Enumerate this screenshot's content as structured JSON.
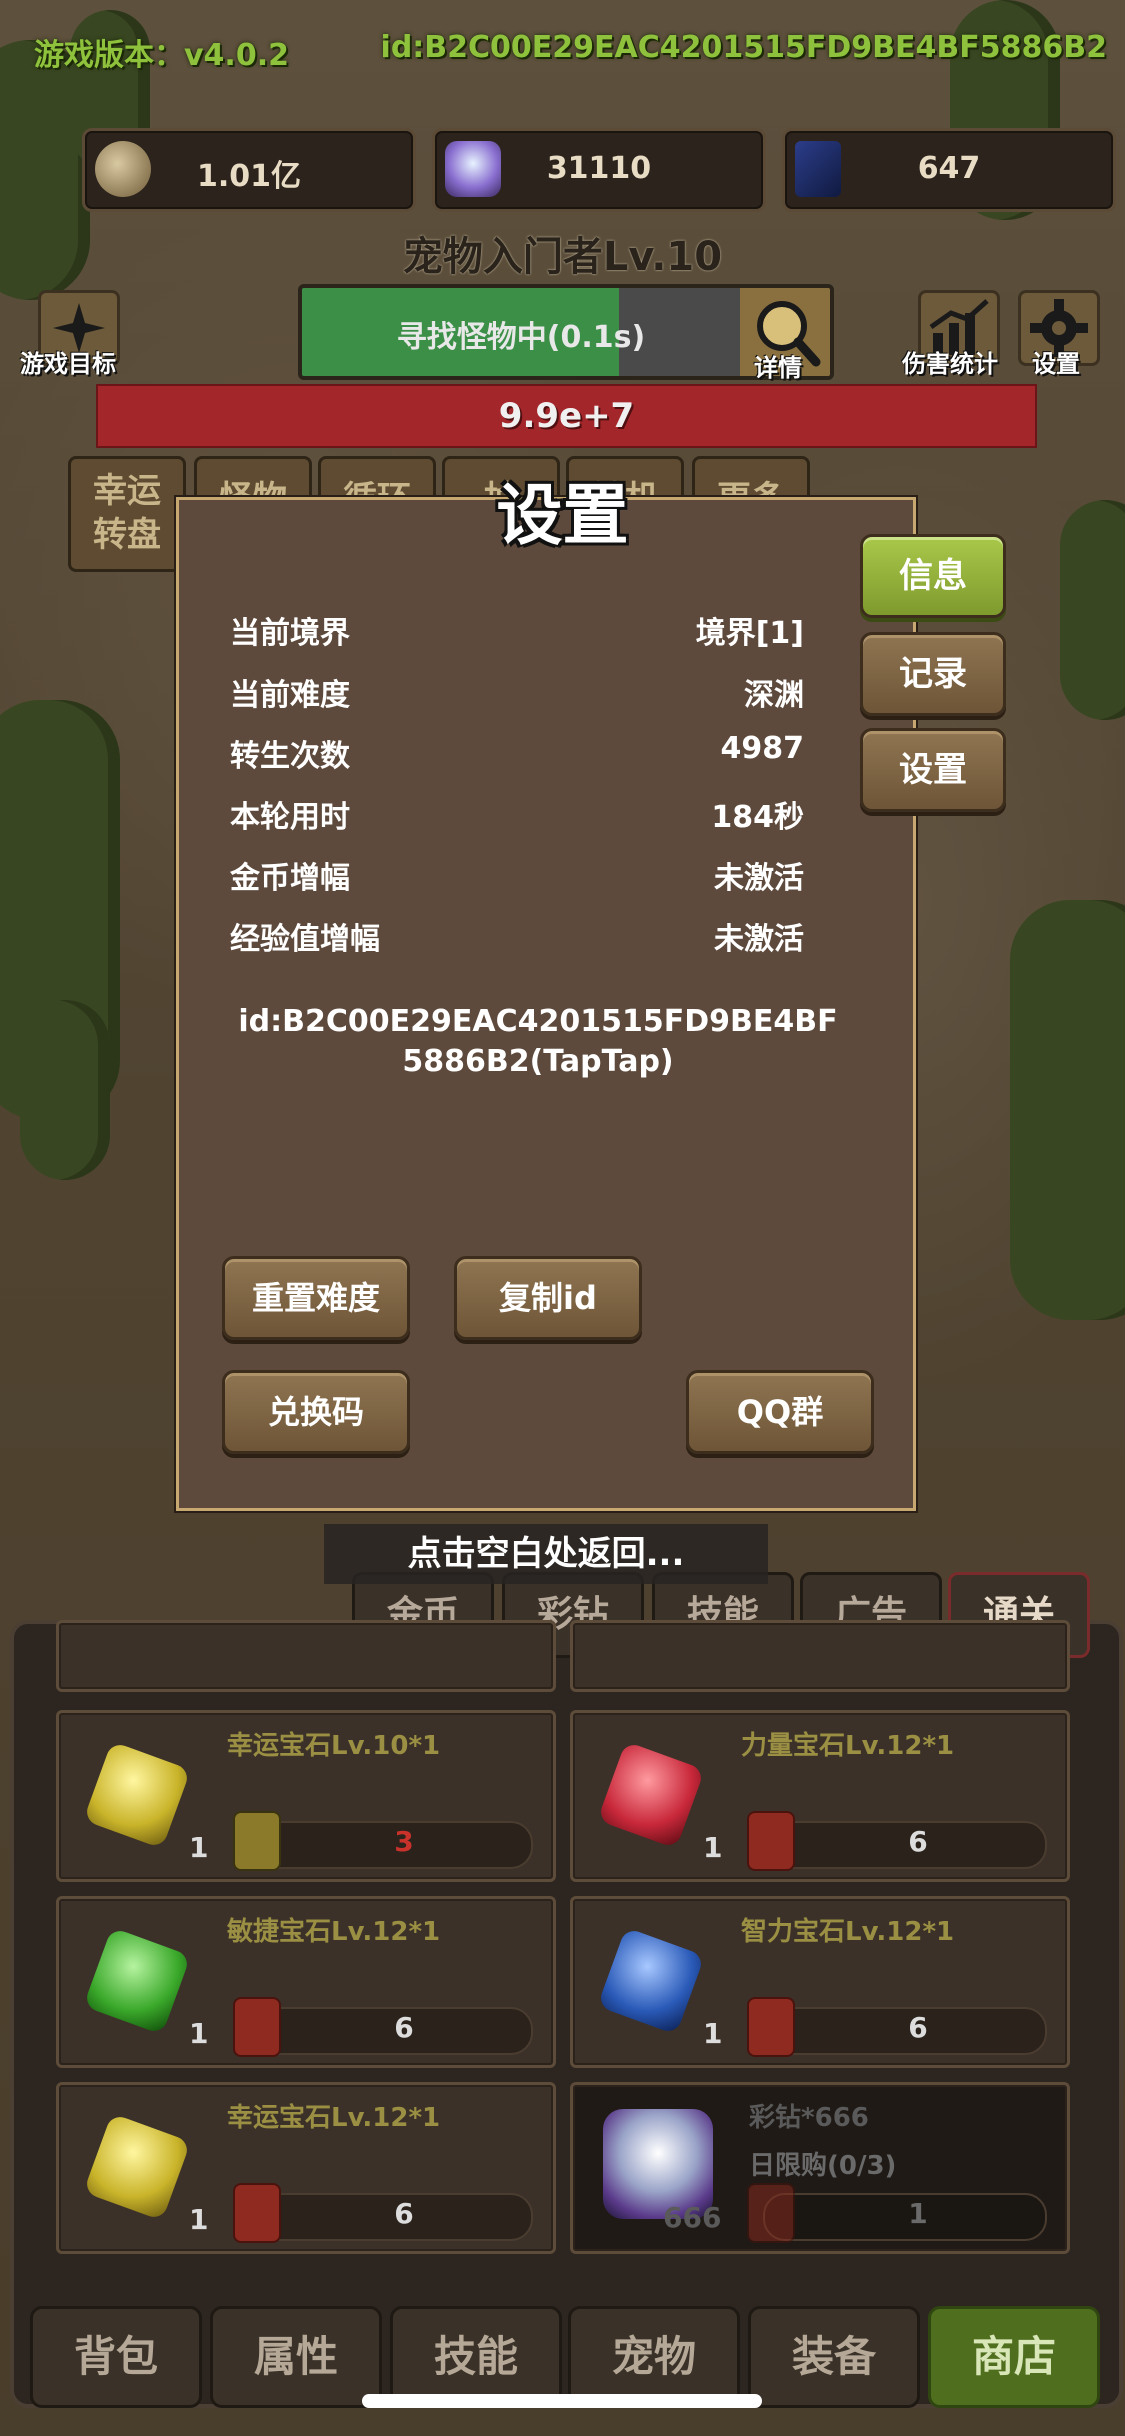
{
  "header": {
    "version": "游戏版本：v4.0.2",
    "id": "id:B2C00E29EAC4201515FD9BE4BF5886B2"
  },
  "resources": [
    {
      "icon": "coin-icon",
      "value": "1.01亿"
    },
    {
      "icon": "crystal-icon",
      "value": "31110"
    },
    {
      "icon": "card-icon",
      "value": "647"
    }
  ],
  "pet_title": "宠物入门者Lv.10",
  "left_button": {
    "icon": "sparkle-icon",
    "label": "游戏目标"
  },
  "search": {
    "text": "寻找怪物中(0.1s)",
    "progress": 0.6,
    "detail_label": "详情"
  },
  "right_buttons": [
    {
      "icon": "chart-icon",
      "label": "伤害统计"
    },
    {
      "icon": "gear-icon",
      "label": "设置"
    }
  ],
  "monster_hp": "9.9e+7",
  "big_tabs": [
    "幸运\n转盘",
    "怪物",
    "循环",
    "抽",
    "转机",
    "更多"
  ],
  "modal": {
    "title": "设置",
    "side_tabs": [
      "信息",
      "记录",
      "设置"
    ],
    "rows": [
      {
        "key": "当前境界",
        "value": "境界[1]"
      },
      {
        "key": "当前难度",
        "value": "深渊"
      },
      {
        "key": "转生次数",
        "value": "4987"
      },
      {
        "key": "本轮用时",
        "value": "184秒"
      },
      {
        "key": "金币增幅",
        "value": "未激活"
      },
      {
        "key": "经验值增幅",
        "value": "未激活"
      }
    ],
    "id_text": "id:B2C00E29EAC4201515FD9BE4BF5886B2(TapTap)",
    "buttons": {
      "reset": "重置难度",
      "copy": "复制id",
      "redeem": "兑换码",
      "qq": "QQ群"
    }
  },
  "hint": "点击空白处返回...",
  "shop_tabs": [
    "金币",
    "彩钻",
    "技能",
    "广告",
    "通关"
  ],
  "shop_items": [
    {
      "name": "幸运宝石Lv.10*1",
      "count": "1",
      "price": "3",
      "gem": "#d8c43a"
    },
    {
      "name": "力量宝石Lv.12*1",
      "count": "1",
      "price": "6",
      "gem": "#c8283a"
    },
    {
      "name": "敏捷宝石Lv.12*1",
      "count": "1",
      "price": "6",
      "gem": "#3aa82a"
    },
    {
      "name": "智力宝石Lv.12*1",
      "count": "1",
      "price": "6",
      "gem": "#2a5ab8"
    },
    {
      "name": "幸运宝石Lv.12*1",
      "count": "1",
      "price": "6",
      "gem": "#d8c43a"
    },
    {
      "name": "彩钻*666",
      "count": "666",
      "price": "1",
      "extra": "日限购(0/3)",
      "gem": "#9aa4c8"
    }
  ],
  "nav_tabs": [
    "背包",
    "属性",
    "技能",
    "宠物",
    "装备",
    "商店"
  ],
  "colors": {
    "accent_green": "#8fc23c",
    "hp_red": "#a3262b",
    "active_green": "#7f9a2d"
  }
}
